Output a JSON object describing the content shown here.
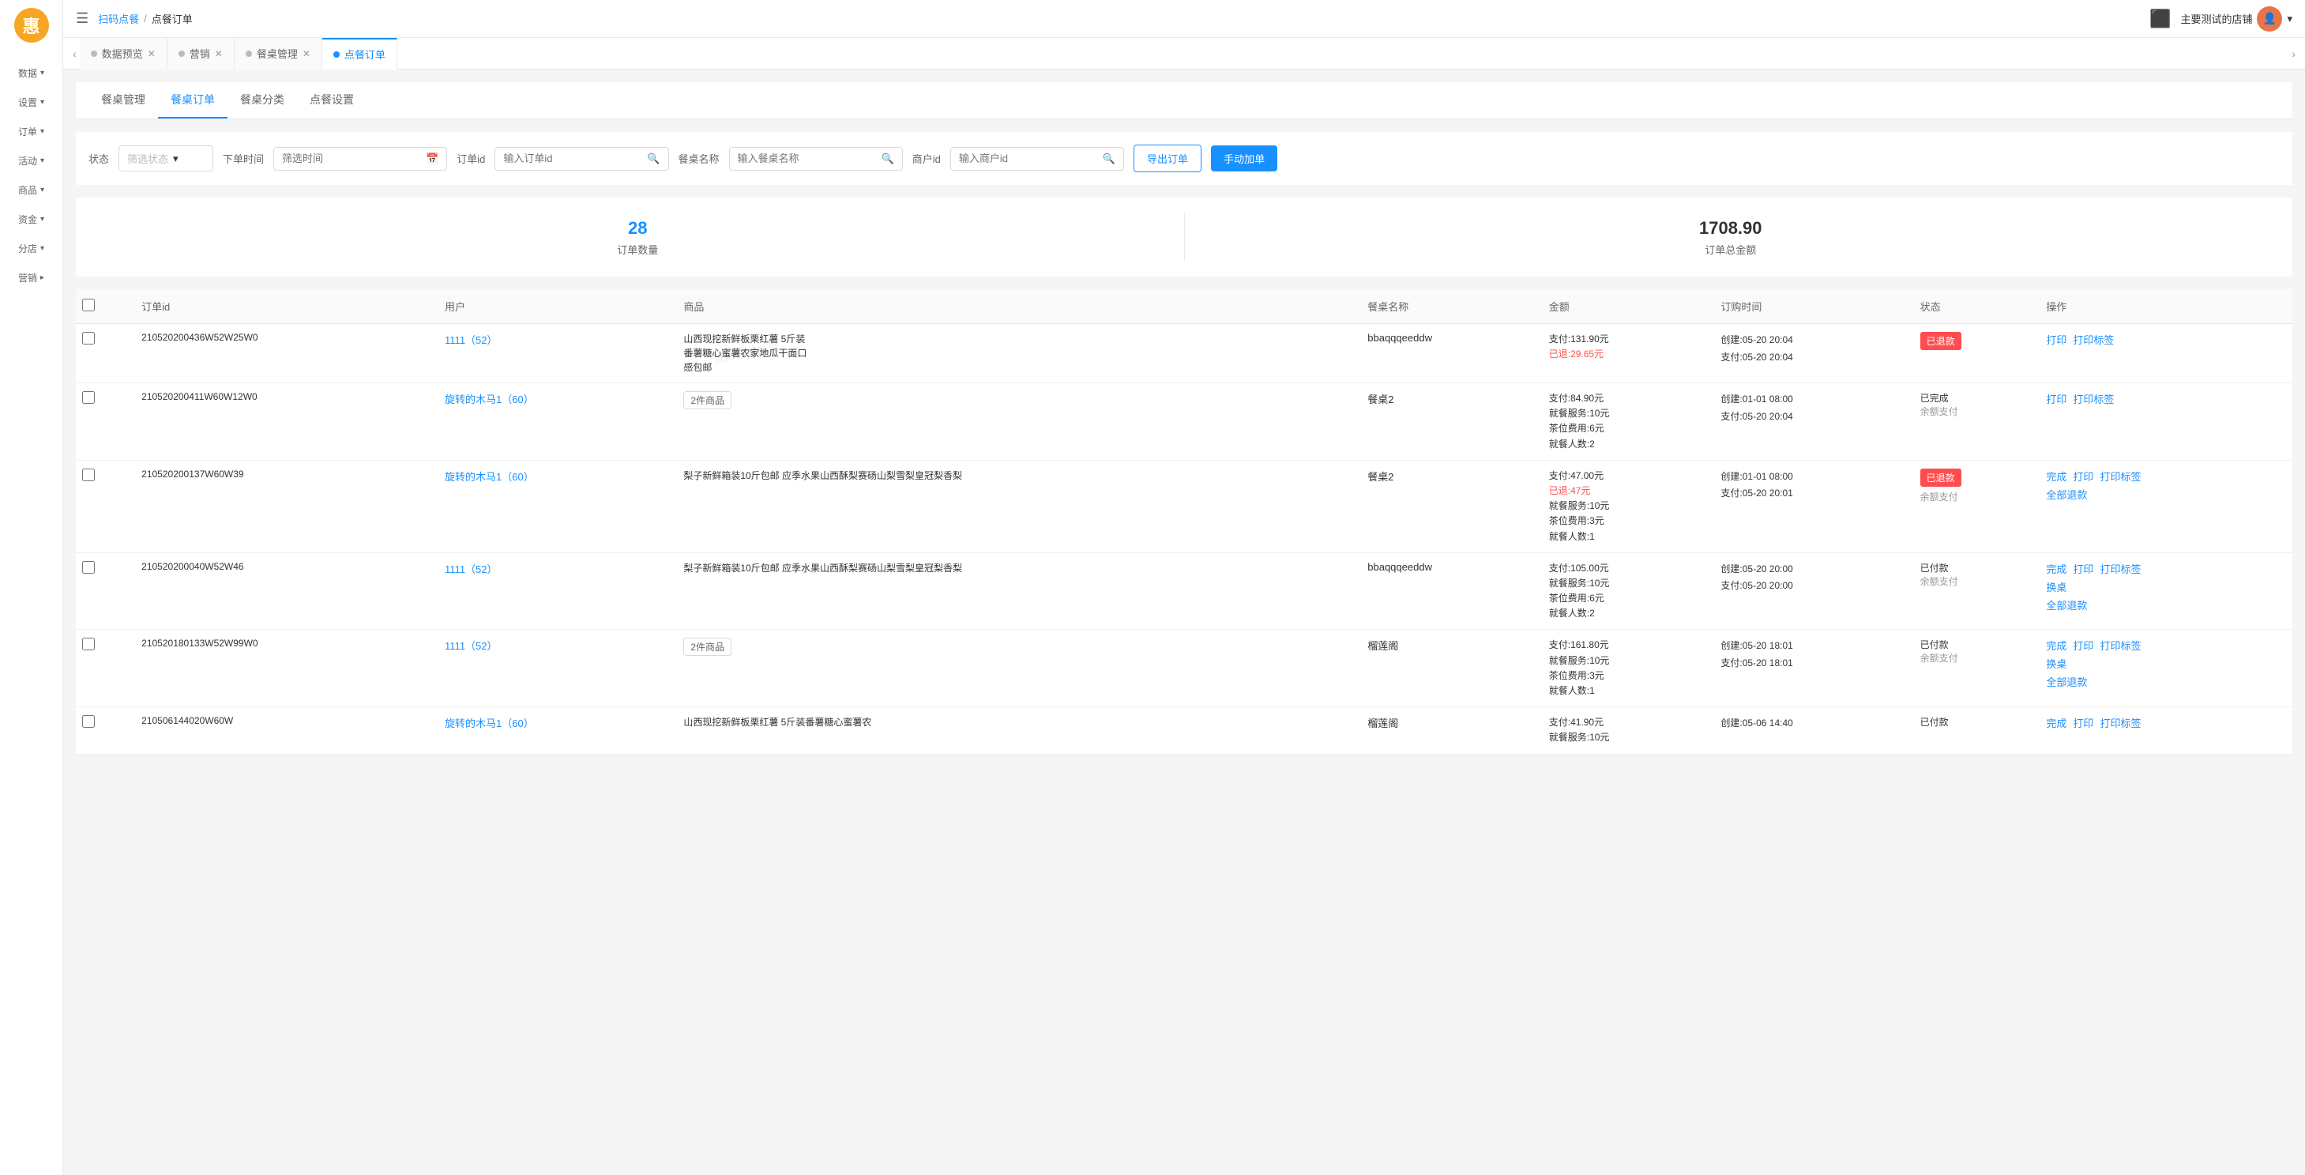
{
  "app": {
    "logo": "惠",
    "store_name": "主要测试的店铺"
  },
  "sidebar": {
    "items": [
      {
        "id": "data",
        "label": "数据",
        "icon": "📊",
        "has_chevron": true
      },
      {
        "id": "settings",
        "label": "设置",
        "icon": "⚙️",
        "has_chevron": true
      },
      {
        "id": "orders",
        "label": "订单",
        "icon": "📋",
        "has_chevron": true
      },
      {
        "id": "activities",
        "label": "活动",
        "icon": "🎯",
        "has_chevron": true
      },
      {
        "id": "goods",
        "label": "商品",
        "icon": "📦",
        "has_chevron": true
      },
      {
        "id": "finance",
        "label": "资金",
        "icon": "💰",
        "has_chevron": true
      },
      {
        "id": "branches",
        "label": "分店",
        "icon": "🏪",
        "has_chevron": true
      },
      {
        "id": "marketing",
        "label": "营销",
        "icon": "📣",
        "has_chevron": false
      }
    ]
  },
  "header": {
    "breadcrumb_parent": "扫码点餐",
    "breadcrumb_sep": "/",
    "breadcrumb_current": "点餐订单",
    "hamburger": "☰"
  },
  "tabs": [
    {
      "label": "数据预览",
      "active": false,
      "dot_active": false
    },
    {
      "label": "营销",
      "active": false,
      "dot_active": false
    },
    {
      "label": "餐桌管理",
      "active": false,
      "dot_active": false
    },
    {
      "label": "点餐订单",
      "active": true,
      "dot_active": true
    }
  ],
  "sub_nav": {
    "items": [
      {
        "label": "餐桌管理",
        "active": false
      },
      {
        "label": "餐桌订单",
        "active": true
      },
      {
        "label": "餐桌分类",
        "active": false
      },
      {
        "label": "点餐设置",
        "active": false
      }
    ]
  },
  "filters": {
    "status_label": "状态",
    "status_placeholder": "筛选状态",
    "time_label": "下单时间",
    "time_placeholder": "筛选时间",
    "order_id_label": "订单id",
    "order_id_placeholder": "输入订单id",
    "table_name_label": "餐桌名称",
    "table_name_placeholder": "输入餐桌名称",
    "merchant_id_label": "商户id",
    "merchant_id_placeholder": "输入商户id",
    "export_btn": "导出订单",
    "add_btn": "手动加单"
  },
  "stats": {
    "order_count": "28",
    "order_count_label": "订单数量",
    "total_amount": "1708.90",
    "total_amount_label": "订单总金额"
  },
  "table": {
    "headers": [
      "",
      "订单id",
      "用户",
      "商品",
      "餐桌名称",
      "金额",
      "订购时间",
      "状态",
      "操作"
    ],
    "rows": [
      {
        "order_id": "210520200436W52W25W0",
        "user": "1111（52）",
        "goods": "山西现挖新鲜板栗红薯 5斤装番薯糖心蜜薯农家地瓜干面口感包邮",
        "goods_tag": null,
        "table_name": "bbaqqqeeddw",
        "amount_pay": "支付:131.90元",
        "amount_refund": "已退:29.65元",
        "time_create": "创建:05-20 20:04",
        "time_pay": "支付:05-20 20:04",
        "status": "已退款",
        "status_type": "refunded",
        "actions": [
          "打印",
          "打印标签"
        ]
      },
      {
        "order_id": "210520200411W60W12W0",
        "user": "旋转的木马1（60）",
        "goods": null,
        "goods_tag": "2件商品",
        "table_name": "餐桌2",
        "amount_pay": "支付:84.90元",
        "amount_service": "就餐服务:10元",
        "amount_tea": "茶位费用:6元",
        "amount_people": "就餐人数:2",
        "time_create": "创建:01-01 08:00",
        "time_pay": "支付:05-20 20:04",
        "status": "已完成",
        "status_type": "completed",
        "payment": "余额支付",
        "actions": [
          "打印",
          "打印标签"
        ]
      },
      {
        "order_id": "210520200137W60W39",
        "user": "旋转的木马1（60）",
        "goods": "梨子新鲜箱装10斤包邮 应季水果山西酥梨赛砀山梨雪梨皇冠梨香梨",
        "goods_tag": null,
        "table_name": "餐桌2",
        "amount_pay": "支付:47.00元",
        "amount_refund": "已退:47元",
        "amount_service": "就餐服务:10元",
        "amount_tea": "茶位费用:3元",
        "amount_people": "就餐人数:1",
        "time_create": "创建:01-01 08:00",
        "time_pay": "支付:05-20 20:01",
        "status": "已退款",
        "status_type": "refunded",
        "payment": "余额支付",
        "actions": [
          "完成",
          "打印",
          "打印标签",
          "全部退款"
        ]
      },
      {
        "order_id": "210520200040W52W46",
        "user": "1111（52）",
        "goods": "梨子新鲜箱装10斤包邮 应季水果山西酥梨赛砀山梨雪梨皇冠梨香梨",
        "goods_tag": null,
        "table_name": "bbaqqqeeddw",
        "amount_pay": "支付:105.00元",
        "amount_service": "就餐服务:10元",
        "amount_tea": "茶位费用:6元",
        "amount_people": "就餐人数:2",
        "time_create": "创建:05-20 20:00",
        "time_pay": "支付:05-20 20:00",
        "status": "已付款",
        "status_type": "paid",
        "payment": "余额支付",
        "actions": [
          "完成",
          "打印",
          "打印标签",
          "换桌",
          "全部退款"
        ]
      },
      {
        "order_id": "210520180133W52W99W0",
        "user": "1111（52）",
        "goods": null,
        "goods_tag": "2件商品",
        "table_name": "榴莲阁",
        "amount_pay": "支付:161.80元",
        "amount_service": "就餐服务:10元",
        "amount_tea": "茶位费用:3元",
        "amount_people": "就餐人数:1",
        "time_create": "创建:05-20 18:01",
        "time_pay": "支付:05-20 18:01",
        "status": "已付款",
        "status_type": "paid",
        "payment": "余额支付",
        "actions": [
          "完成",
          "打印",
          "打印标签",
          "换桌",
          "全部退款"
        ]
      },
      {
        "order_id": "210506144020W60W",
        "user": "旋转的木马1（60）",
        "goods": "山西现挖新鲜板栗红薯 5斤装番薯糖心蜜薯农",
        "goods_tag": null,
        "table_name": "榴莲阁",
        "amount_pay": "支付:41.90元",
        "amount_service": "就餐服务:10元",
        "time_create": "创建:05-06 14:40",
        "time_pay": "",
        "status": "已付款",
        "status_type": "paid",
        "payment": "",
        "actions": [
          "完成",
          "打印",
          "打印标签"
        ]
      }
    ]
  }
}
